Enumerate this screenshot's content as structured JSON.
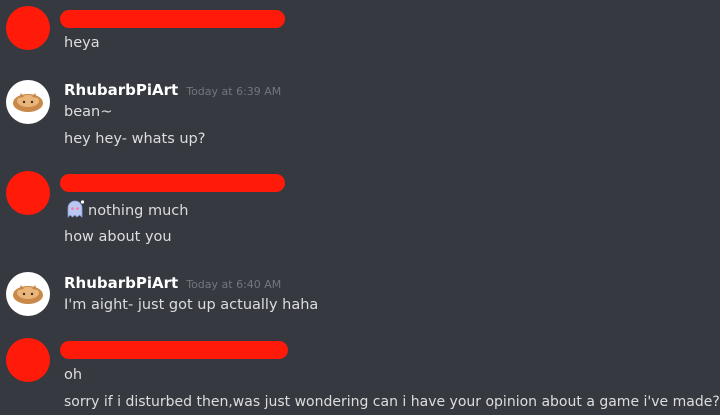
{
  "colors": {
    "background": "#36393f",
    "text": "#dcddde",
    "username": "#ffffff",
    "timestamp": "#72767d",
    "redaction": "#ff1a0a"
  },
  "messages": [
    {
      "author": "",
      "timestamp": "",
      "avatar": "redacted-avatar",
      "lines": [
        "heya"
      ]
    },
    {
      "author": "RhubarbPiArt",
      "timestamp": "Today at 6:39 AM",
      "avatar": "bread-cat-avatar",
      "lines": [
        "bean~",
        "hey hey- whats up?"
      ]
    },
    {
      "author": "",
      "timestamp": "",
      "avatar": "redacted-avatar",
      "lines": [
        "nothing much",
        "how about you"
      ],
      "line_emoji": "blue-ghost-emoji"
    },
    {
      "author": "RhubarbPiArt",
      "timestamp": "Today at 6:40 AM",
      "avatar": "bread-cat-avatar",
      "lines": [
        "I'm aight- just got up actually haha"
      ]
    },
    {
      "author": "",
      "timestamp": "",
      "avatar": "redacted-avatar",
      "lines": [
        "oh",
        "sorry if i disturbed then,was just wondering can i have your opinion about a game i've made?"
      ]
    }
  ]
}
